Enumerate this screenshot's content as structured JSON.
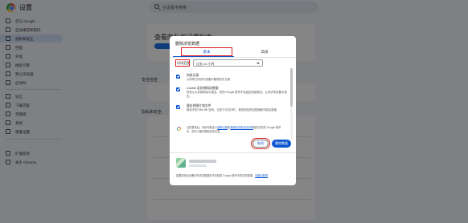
{
  "app": {
    "title": "设置"
  },
  "search": {
    "placeholder": "在设置中搜索"
  },
  "sidebar": {
    "items": [
      {
        "label": "您与 Google",
        "active": false
      },
      {
        "label": "自动填充和密码",
        "active": false
      },
      {
        "label": "隐私和安全",
        "active": true
      },
      {
        "label": "性能",
        "active": false
      },
      {
        "label": "外观",
        "active": false
      },
      {
        "label": "搜索引擎",
        "active": false
      },
      {
        "label": "默认浏览器",
        "active": false
      },
      {
        "label": "启动时",
        "active": false
      },
      {
        "label": "语言",
        "active": false
      },
      {
        "label": "下载内容",
        "active": false
      },
      {
        "label": "无障碍",
        "active": false
      },
      {
        "label": "系统",
        "active": false
      },
      {
        "label": "重置设置",
        "active": false
      },
      {
        "label": "扩展程序",
        "active": false
      },
      {
        "label": "关于 Chrome",
        "active": false
      }
    ]
  },
  "background": {
    "card_title": "查看隐私权设置指南",
    "section_safety": "安全检查",
    "section_privacy": "隐私和安全"
  },
  "dialog": {
    "title": "删除浏览数据",
    "tabs": {
      "basic": "基本",
      "advanced": "高级"
    },
    "time_range": {
      "label": "时间范围",
      "value": "过去 24 小时"
    },
    "options": [
      {
        "title": "浏览记录",
        "desc": "从所有已同步的设备中删除历史记录",
        "checked": true
      },
      {
        "title": "Cookie 及其他网站数据",
        "desc": "将您从大多数网站中退出。您的 Google 账号不会因此而被退出。从同步的设备中退出。",
        "checked": true
      },
      {
        "title": "缓存的图片和文件",
        "desc": "释放不到 358 MB 空间。当您下次访问时，某些网站的加载速度可能会更慢。",
        "checked": true
      }
    ],
    "info": {
      "prefix": "当您登录后，系统可能会以",
      "link1": "搜索记录",
      "middle": "和",
      "link2": "其他形式的活动记录",
      "suffix": "保存在您的 Google 账号中。您可以随时删除这些记录。"
    },
    "buttons": {
      "cancel": "取消",
      "delete": "删除数据"
    },
    "footer": {
      "text": "如要清除此设备中的浏览数据但不清除您 Google 账号中的浏览数据，",
      "link": "请退出登录"
    }
  }
}
